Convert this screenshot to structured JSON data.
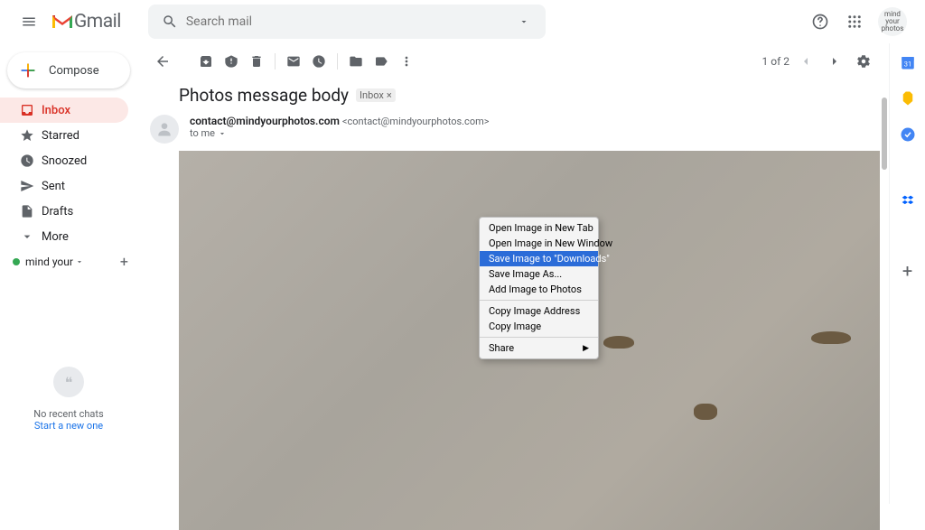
{
  "header": {
    "logo_text": "Gmail",
    "search_placeholder": "Search mail",
    "profile_text": "mind your photos"
  },
  "sidebar": {
    "compose_label": "Compose",
    "items": [
      {
        "label": "Inbox"
      },
      {
        "label": "Starred"
      },
      {
        "label": "Snoozed"
      },
      {
        "label": "Sent"
      },
      {
        "label": "Drafts"
      },
      {
        "label": "More"
      }
    ],
    "hangout_label": "mind your",
    "chat_none": "No recent chats",
    "chat_start": "Start a new one"
  },
  "toolbar": {
    "page_count": "1 of 2"
  },
  "message": {
    "subject": "Photos message body",
    "chip": "Inbox",
    "sender_name": "contact@mindyourphotos.com",
    "sender_email": "<contact@mindyourphotos.com>",
    "to_line": "to me"
  },
  "context_menu": {
    "items": [
      "Open Image in New Tab",
      "Open Image in New Window",
      "Save Image to \"Downloads\"",
      "Save Image As...",
      "Add Image to Photos",
      "Copy Image Address",
      "Copy Image",
      "Share"
    ],
    "selected_index": 2
  }
}
